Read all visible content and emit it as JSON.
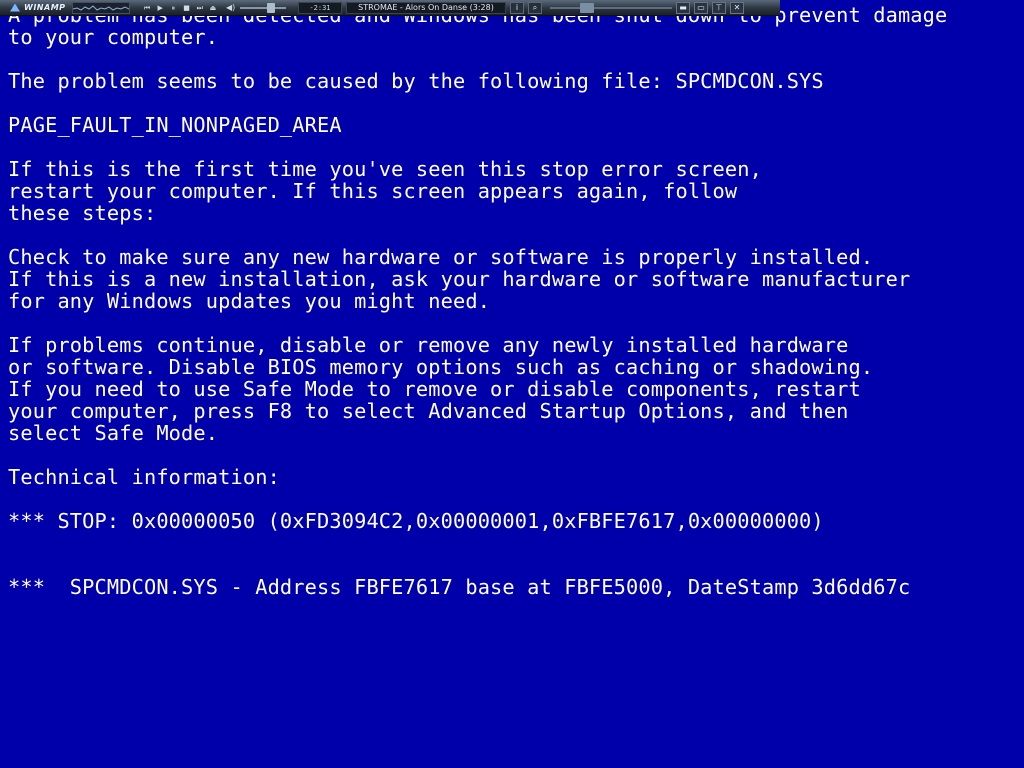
{
  "winamp": {
    "logo": "WINAMP",
    "time": "-2:31",
    "now_playing": "STROMAE - Alors On Danse (3:28)",
    "seek_fraction": 0.28,
    "volume_fraction": 0.7,
    "controls": {
      "prev": "⏮",
      "play": "▶",
      "pause": "⏸",
      "stop": "■",
      "next": "⏭",
      "eject": "⏏"
    },
    "info_btn": "i",
    "search_btn": "⌕",
    "window_btns": {
      "shade": "▬",
      "restore": "▭",
      "pin": "⊤",
      "close": "✕"
    }
  },
  "bsod": {
    "intro": [
      "A problem has been detected and Windows has been shut down to prevent damage",
      "to your computer."
    ],
    "cause": "The problem seems to be caused by the following file: SPCMDCON.SYS",
    "error_code": "PAGE_FAULT_IN_NONPAGED_AREA",
    "first_time": [
      "If this is the first time you've seen this stop error screen,",
      "restart your computer. If this screen appears again, follow",
      "these steps:"
    ],
    "check": [
      "Check to make sure any new hardware or software is properly installed.",
      "If this is a new installation, ask your hardware or software manufacturer",
      "for any Windows updates you might need."
    ],
    "continue": [
      "If problems continue, disable or remove any newly installed hardware",
      "or software. Disable BIOS memory options such as caching or shadowing.",
      "If you need to use Safe Mode to remove or disable components, restart",
      "your computer, press F8 to select Advanced Startup Options, and then",
      "select Safe Mode."
    ],
    "tech_header": "Technical information:",
    "stop_line": "*** STOP: 0x00000050 (0xFD3094C2,0x00000001,0xFBFE7617,0x00000000)",
    "driver_line": "***  SPCMDCON.SYS - Address FBFE7617 base at FBFE5000, DateStamp 3d6dd67c"
  },
  "colors": {
    "background": "#0000AA",
    "text": "#FFFFFF"
  }
}
